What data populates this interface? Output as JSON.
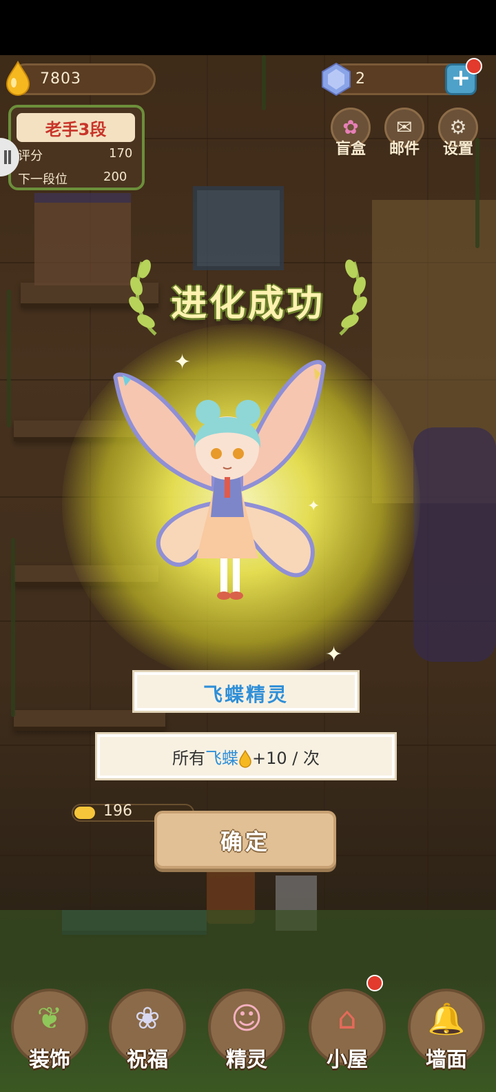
{
  "hud": {
    "coins": "7803",
    "gems": "2",
    "plus_label": "+"
  },
  "rank": {
    "title": "老手3段",
    "score_label": "评分",
    "score_value": "170",
    "next_label": "下一段位",
    "next_value": "200"
  },
  "top_menu": [
    {
      "label": "盲盒",
      "icon": "flower-icon"
    },
    {
      "label": "邮件",
      "icon": "mail-icon"
    },
    {
      "label": "设置",
      "icon": "gear-icon"
    }
  ],
  "popup": {
    "title": "进化成功",
    "fairy_name": "飞蝶精灵",
    "effect_prefix": "所有",
    "effect_target": "飞蝶",
    "effect_suffix": "+10 / 次",
    "confirm_label": "确定"
  },
  "jar": {
    "value": "196"
  },
  "bottom_nav": [
    {
      "label": "装饰",
      "icon": "plant-icon"
    },
    {
      "label": "祝福",
      "icon": "butterfly-icon"
    },
    {
      "label": "精灵",
      "icon": "fairy-icon"
    },
    {
      "label": "小屋",
      "icon": "house-icon"
    },
    {
      "label": "墙面",
      "icon": "bell-icon"
    }
  ],
  "colors": {
    "accent_blue": "#2f8fd8",
    "title_yellow": "#fff2b0",
    "glow": "#f5f03a",
    "badge_red": "#e23a2c"
  }
}
